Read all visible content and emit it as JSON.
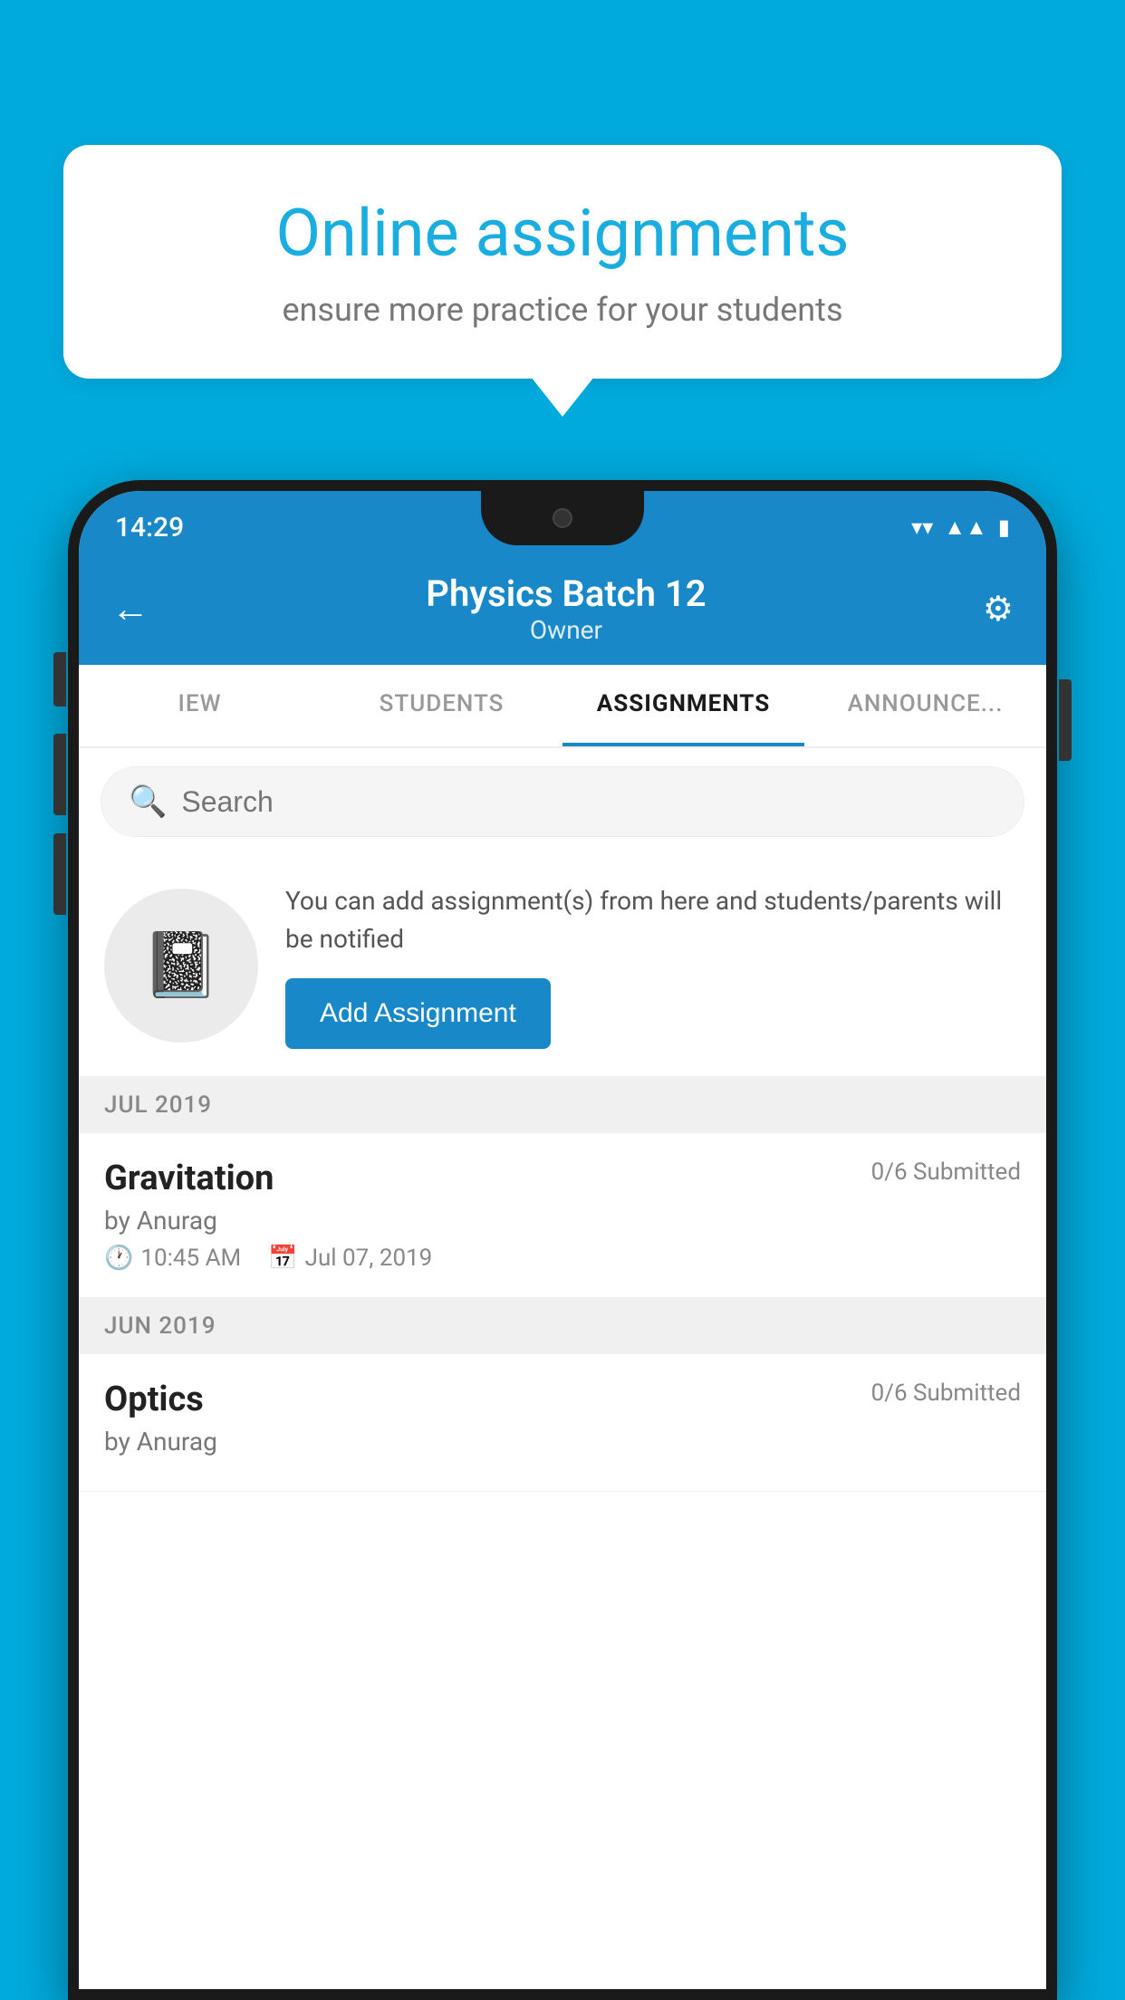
{
  "background_color": "#00AADD",
  "speech_bubble": {
    "title": "Online assignments",
    "subtitle": "ensure more practice for your students"
  },
  "status_bar": {
    "time": "14:29",
    "wifi": "▼",
    "signal": "▲",
    "battery": "▮"
  },
  "header": {
    "title": "Physics Batch 12",
    "subtitle": "Owner",
    "back_label": "←",
    "settings_label": "⚙"
  },
  "tabs": [
    {
      "label": "IEW",
      "active": false
    },
    {
      "label": "STUDENTS",
      "active": false
    },
    {
      "label": "ASSIGNMENTS",
      "active": true
    },
    {
      "label": "ANNOUNCEMENTS",
      "active": false
    }
  ],
  "search": {
    "placeholder": "Search"
  },
  "promo_card": {
    "text": "You can add assignment(s) from here and students/parents will be notified",
    "button_label": "Add Assignment"
  },
  "sections": [
    {
      "label": "JUL 2019",
      "assignments": [
        {
          "name": "Gravitation",
          "submitted": "0/6 Submitted",
          "by": "by Anurag",
          "time": "10:45 AM",
          "date": "Jul 07, 2019"
        }
      ]
    },
    {
      "label": "JUN 2019",
      "assignments": [
        {
          "name": "Optics",
          "submitted": "0/6 Submitted",
          "by": "by Anurag",
          "time": "",
          "date": ""
        }
      ]
    }
  ]
}
